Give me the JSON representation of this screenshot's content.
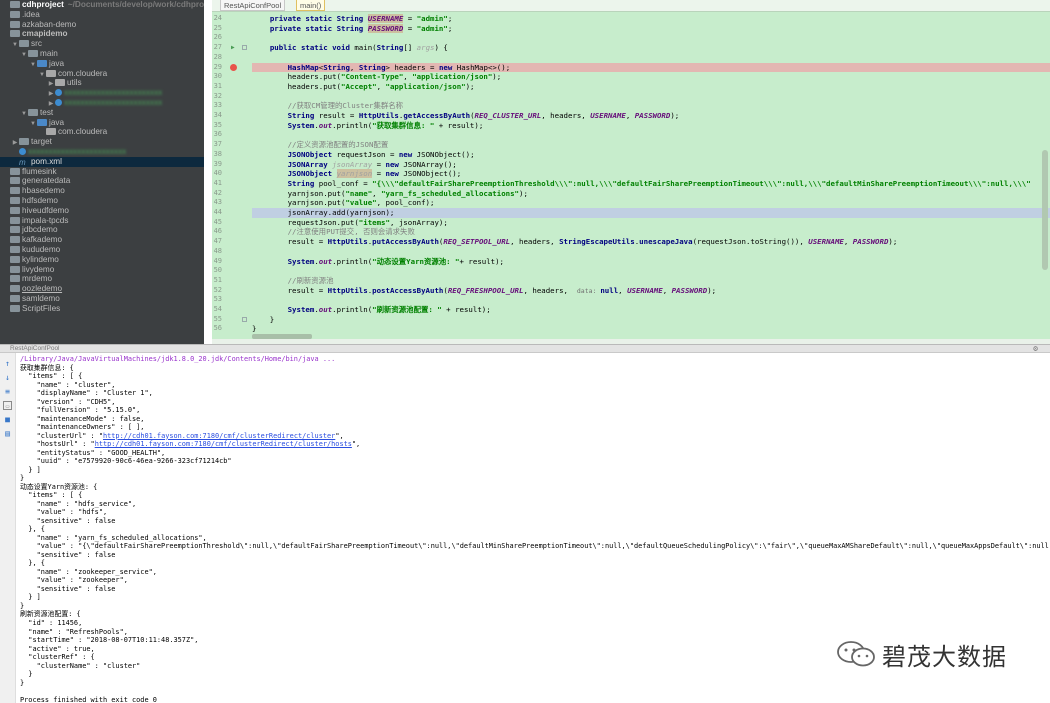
{
  "sidebar": {
    "items": [
      {
        "label": "cdhproject",
        "hint": "~/Documents/develop/work/cdhproject",
        "depth": 0,
        "icon": "folder",
        "root": true
      },
      {
        "label": ".idea",
        "depth": 0,
        "icon": "folder"
      },
      {
        "label": "azkaban-demo",
        "depth": 0,
        "icon": "folder"
      },
      {
        "label": "cmapidemo",
        "depth": 0,
        "icon": "folder",
        "bold": true
      },
      {
        "label": "src",
        "depth": 1,
        "icon": "folder",
        "arrow": "open"
      },
      {
        "label": "main",
        "depth": 2,
        "icon": "folder",
        "arrow": "open"
      },
      {
        "label": "java",
        "depth": 3,
        "icon": "src",
        "arrow": "open"
      },
      {
        "label": "com.cloudera",
        "depth": 4,
        "icon": "pkg",
        "arrow": "open"
      },
      {
        "label": "utils",
        "depth": 5,
        "icon": "pkg",
        "arrow": "closed"
      },
      {
        "label": "",
        "depth": 5,
        "icon": "cls",
        "arrow": "closed",
        "blurred": true
      },
      {
        "label": "",
        "depth": 5,
        "icon": "cls",
        "arrow": "closed",
        "blurred": true
      },
      {
        "label": "test",
        "depth": 2,
        "icon": "folder",
        "arrow": "open"
      },
      {
        "label": "java",
        "depth": 3,
        "icon": "src",
        "arrow": "open"
      },
      {
        "label": "com.cloudera",
        "depth": 4,
        "icon": "pkg"
      },
      {
        "label": "target",
        "depth": 1,
        "icon": "folder",
        "arrow": "closed"
      },
      {
        "label": "",
        "depth": 1,
        "icon": "cls",
        "blurred": true
      },
      {
        "label": "pom.xml",
        "depth": 1,
        "icon": "xml",
        "selected": true
      },
      {
        "label": "flumesink",
        "depth": 0,
        "icon": "folder"
      },
      {
        "label": "generatedata",
        "depth": 0,
        "icon": "folder"
      },
      {
        "label": "hbasedemo",
        "depth": 0,
        "icon": "folder"
      },
      {
        "label": "hdfsdemo",
        "depth": 0,
        "icon": "folder"
      },
      {
        "label": "hiveudfdemo",
        "depth": 0,
        "icon": "folder"
      },
      {
        "label": "impala-tpcds",
        "depth": 0,
        "icon": "folder"
      },
      {
        "label": "jdbcdemo",
        "depth": 0,
        "icon": "folder"
      },
      {
        "label": "kafkademo",
        "depth": 0,
        "icon": "folder"
      },
      {
        "label": "kududemo",
        "depth": 0,
        "icon": "folder"
      },
      {
        "label": "kylindemo",
        "depth": 0,
        "icon": "folder"
      },
      {
        "label": "livydemo",
        "depth": 0,
        "icon": "folder"
      },
      {
        "label": "mrdemo",
        "depth": 0,
        "icon": "folder"
      },
      {
        "label": "oozledemo",
        "depth": 0,
        "icon": "folder",
        "underline": true
      },
      {
        "label": "samldemo",
        "depth": 0,
        "icon": "folder"
      },
      {
        "label": "ScriptFiles",
        "depth": 0,
        "icon": "folder"
      }
    ]
  },
  "editor": {
    "tabs": [
      {
        "label": "RestApiConfPool",
        "active": false
      },
      {
        "label": "main()",
        "active": true
      }
    ],
    "line_numbers": [
      "24",
      "25",
      "26",
      "27",
      "28",
      "29",
      "30",
      "31",
      "32",
      "33",
      "34",
      "35",
      "36",
      "37",
      "38",
      "39",
      "40",
      "41",
      "42",
      "43",
      "44",
      "45",
      "46",
      "47",
      "48",
      "49",
      "50",
      "51",
      "52",
      "53",
      "54",
      "55",
      "56"
    ],
    "lines": [
      [
        {
          "t": "    "
        },
        {
          "t": "private static ",
          "c": "kw"
        },
        {
          "t": "String ",
          "c": "typ"
        },
        {
          "t": "USERNAME",
          "c": "fld mark"
        },
        {
          "t": " = "
        },
        {
          "t": "\"admin\"",
          "c": "str"
        },
        {
          "t": ";"
        }
      ],
      [
        {
          "t": "    "
        },
        {
          "t": "private static ",
          "c": "kw"
        },
        {
          "t": "String ",
          "c": "typ"
        },
        {
          "t": "PASSWORD",
          "c": "fld mark"
        },
        {
          "t": " = "
        },
        {
          "t": "\"admin\"",
          "c": "str"
        },
        {
          "t": ";"
        }
      ],
      [
        {
          "t": ""
        }
      ],
      [
        {
          "t": "    "
        },
        {
          "t": "public static void ",
          "c": "kw"
        },
        {
          "t": "main("
        },
        {
          "t": "String",
          "c": "typ"
        },
        {
          "t": "[] "
        },
        {
          "t": "args",
          "c": "var"
        },
        {
          "t": ") {"
        }
      ],
      [
        {
          "t": ""
        }
      ],
      [
        {
          "t": "        "
        },
        {
          "t": "HashMap",
          "c": "typ"
        },
        {
          "t": "<"
        },
        {
          "t": "String",
          "c": "typ"
        },
        {
          "t": ", "
        },
        {
          "t": "String",
          "c": "typ"
        },
        {
          "t": "> headers = "
        },
        {
          "t": "new ",
          "c": "kw"
        },
        {
          "t": "HashMap<>();"
        }
      ],
      [
        {
          "t": "        headers.put("
        },
        {
          "t": "\"Content-Type\"",
          "c": "str"
        },
        {
          "t": ", "
        },
        {
          "t": "\"application/json\"",
          "c": "str"
        },
        {
          "t": ");"
        }
      ],
      [
        {
          "t": "        headers.put("
        },
        {
          "t": "\"Accept\"",
          "c": "str"
        },
        {
          "t": ", "
        },
        {
          "t": "\"application/json\"",
          "c": "str"
        },
        {
          "t": ");"
        }
      ],
      [
        {
          "t": ""
        }
      ],
      [
        {
          "t": "        "
        },
        {
          "t": "//获取CM管理的Cluster集群名称",
          "c": "cmt"
        }
      ],
      [
        {
          "t": "        "
        },
        {
          "t": "String ",
          "c": "typ"
        },
        {
          "t": "result = "
        },
        {
          "t": "HttpUtils",
          "c": "typ"
        },
        {
          "t": "."
        },
        {
          "t": "getAccessByAuth",
          "c": "typ"
        },
        {
          "t": "("
        },
        {
          "t": "REQ_CLUSTER_URL",
          "c": "fld"
        },
        {
          "t": ", headers, "
        },
        {
          "t": "USERNAME",
          "c": "fld"
        },
        {
          "t": ", "
        },
        {
          "t": "PASSWORD",
          "c": "fld"
        },
        {
          "t": ");"
        }
      ],
      [
        {
          "t": "        "
        },
        {
          "t": "System",
          "c": "typ"
        },
        {
          "t": "."
        },
        {
          "t": "out",
          "c": "fld"
        },
        {
          "t": ".println("
        },
        {
          "t": "\"获取集群信息: \"",
          "c": "str"
        },
        {
          "t": " + result);"
        }
      ],
      [
        {
          "t": ""
        }
      ],
      [
        {
          "t": "        "
        },
        {
          "t": "//定义资源池配置的JSON配置",
          "c": "cmt"
        }
      ],
      [
        {
          "t": "        "
        },
        {
          "t": "JSONObject ",
          "c": "typ"
        },
        {
          "t": "requestJson = "
        },
        {
          "t": "new ",
          "c": "kw"
        },
        {
          "t": "JSONObject();"
        }
      ],
      [
        {
          "t": "        "
        },
        {
          "t": "JSONArray ",
          "c": "typ"
        },
        {
          "t": "jsonArray",
          "c": "var"
        },
        {
          "t": " = "
        },
        {
          "t": "new ",
          "c": "kw"
        },
        {
          "t": "JSONArray();"
        }
      ],
      [
        {
          "t": "        "
        },
        {
          "t": "JSONObject ",
          "c": "typ"
        },
        {
          "t": "yarnjson",
          "c": "var mark"
        },
        {
          "t": " = "
        },
        {
          "t": "new ",
          "c": "kw"
        },
        {
          "t": "JSONObject();"
        }
      ],
      [
        {
          "t": "        "
        },
        {
          "t": "String ",
          "c": "typ"
        },
        {
          "t": "pool_conf = "
        },
        {
          "t": "\"{\\\\\\\"defaultFairSharePreemptionThreshold\\\\\\\":null,\\\\\\\"defaultFairSharePreemptionTimeout\\\\\\\":null,\\\\\\\"defaultMinSharePreemptionTimeout\\\\\\\":null,\\\\\\\"",
          "c": "str"
        }
      ],
      [
        {
          "t": "        yarnjson.put("
        },
        {
          "t": "\"name\"",
          "c": "str"
        },
        {
          "t": ", "
        },
        {
          "t": "\"yarn_fs_scheduled_allocations\"",
          "c": "str"
        },
        {
          "t": ");"
        }
      ],
      [
        {
          "t": "        yarnjson.put("
        },
        {
          "t": "\"value\"",
          "c": "str"
        },
        {
          "t": ", pool_conf);"
        }
      ],
      [
        {
          "t": "        jsonArray.add(yarnjson);"
        }
      ],
      [
        {
          "t": "        requestJson.put("
        },
        {
          "t": "\"items\"",
          "c": "str"
        },
        {
          "t": ", jsonArray);"
        }
      ],
      [
        {
          "t": "        "
        },
        {
          "t": "//注意使用PUT提交, 否则会请求失败",
          "c": "cmt"
        }
      ],
      [
        {
          "t": "        result = "
        },
        {
          "t": "HttpUtils",
          "c": "typ"
        },
        {
          "t": "."
        },
        {
          "t": "putAccessByAuth",
          "c": "typ"
        },
        {
          "t": "("
        },
        {
          "t": "REQ_SETPOOL_URL",
          "c": "fld"
        },
        {
          "t": ", headers, "
        },
        {
          "t": "StringEscapeUtils",
          "c": "typ"
        },
        {
          "t": "."
        },
        {
          "t": "unescapeJava",
          "c": "typ"
        },
        {
          "t": "(requestJson.toString()), "
        },
        {
          "t": "USERNAME",
          "c": "fld"
        },
        {
          "t": ", "
        },
        {
          "t": "PASSWORD",
          "c": "fld"
        },
        {
          "t": ");"
        }
      ],
      [
        {
          "t": ""
        }
      ],
      [
        {
          "t": "        "
        },
        {
          "t": "System",
          "c": "typ"
        },
        {
          "t": "."
        },
        {
          "t": "out",
          "c": "fld"
        },
        {
          "t": ".println("
        },
        {
          "t": "\"动态设置Yarn资源池: \"",
          "c": "str"
        },
        {
          "t": "+ result);"
        }
      ],
      [
        {
          "t": ""
        }
      ],
      [
        {
          "t": "        "
        },
        {
          "t": "//刷新资源池",
          "c": "cmt"
        }
      ],
      [
        {
          "t": "        result = "
        },
        {
          "t": "HttpUtils",
          "c": "typ"
        },
        {
          "t": "."
        },
        {
          "t": "postAccessByAuth",
          "c": "typ"
        },
        {
          "t": "("
        },
        {
          "t": "REQ_FRESHPOOL_URL",
          "c": "fld"
        },
        {
          "t": ", headers,  "
        },
        {
          "t": "data: ",
          "c": "hint2"
        },
        {
          "t": "null",
          "c": "kw"
        },
        {
          "t": ", "
        },
        {
          "t": "USERNAME",
          "c": "fld"
        },
        {
          "t": ", "
        },
        {
          "t": "PASSWORD",
          "c": "fld"
        },
        {
          "t": ");"
        }
      ],
      [
        {
          "t": ""
        }
      ],
      [
        {
          "t": "        "
        },
        {
          "t": "System",
          "c": "typ"
        },
        {
          "t": "."
        },
        {
          "t": "out",
          "c": "fld"
        },
        {
          "t": ".println("
        },
        {
          "t": "\"刷新资源池配置: \"",
          "c": "str"
        },
        {
          "t": " + result);"
        }
      ],
      [
        {
          "t": "    }"
        }
      ],
      [
        {
          "t": "}"
        }
      ]
    ],
    "highlight_line": 20,
    "error_line": 5,
    "breakpoint_line": 5,
    "run_line": 3
  },
  "run": {
    "title": "RestApiConfPool",
    "lines": [
      {
        "t": "/Library/Java/JavaVirtualMachines/jdk1.8.0_20.jdk/Contents/Home/bin/java ...",
        "cls": "cmdline"
      },
      {
        "t": "获取集群信息: {"
      },
      {
        "t": "  \"items\" : [ {"
      },
      {
        "t": "    \"name\" : \"cluster\","
      },
      {
        "t": "    \"displayName\" : \"Cluster 1\","
      },
      {
        "t": "    \"version\" : \"CDH5\","
      },
      {
        "t": "    \"fullVersion\" : \"5.15.0\","
      },
      {
        "t": "    \"maintenanceMode\" : false,"
      },
      {
        "t": "    \"maintenanceOwners\" : [ ],"
      },
      {
        "t": "    \"clusterUrl\" : \"",
        "link": "http://cdh01.fayson.com:7180/cmf/clusterRedirect/cluster",
        "tail": "\","
      },
      {
        "t": "    \"hostsUrl\" : \"",
        "link": "http://cdh01.fayson.com:7180/cmf/clusterRedirect/cluster/hosts",
        "tail": "\","
      },
      {
        "t": "    \"entityStatus\" : \"GOOD_HEALTH\","
      },
      {
        "t": "    \"uuid\" : \"e7579920-90c6-46ea-9266-323cf71214cb\""
      },
      {
        "t": "  } ]"
      },
      {
        "t": "}"
      },
      {
        "t": "动态设置Yarn资源池: {"
      },
      {
        "t": "  \"items\" : [ {"
      },
      {
        "t": "    \"name\" : \"hdfs_service\","
      },
      {
        "t": "    \"value\" : \"hdfs\","
      },
      {
        "t": "    \"sensitive\" : false"
      },
      {
        "t": "  }, {"
      },
      {
        "t": "    \"name\" : \"yarn_fs_scheduled_allocations\","
      },
      {
        "t": "    \"value\" : \"{\\\"defaultFairSharePreemptionThreshold\\\":null,\\\"defaultFairSharePreemptionTimeout\\\":null,\\\"defaultMinSharePreemptionTimeout\\\":null,\\\"defaultQueueSchedulingPolicy\\\":\\\"fair\\\",\\\"queueMaxAMShareDefault\\\":null,\\\"queueMaxAppsDefault\\\":null,\\\"queueF"
      },
      {
        "t": "    \"sensitive\" : false"
      },
      {
        "t": "  }, {"
      },
      {
        "t": "    \"name\" : \"zookeeper_service\","
      },
      {
        "t": "    \"value\" : \"zookeeper\","
      },
      {
        "t": "    \"sensitive\" : false"
      },
      {
        "t": "  } ]"
      },
      {
        "t": "}"
      },
      {
        "t": "刷新资源池配置: {"
      },
      {
        "t": "  \"id\" : 11456,"
      },
      {
        "t": "  \"name\" : \"RefreshPools\","
      },
      {
        "t": "  \"startTime\" : \"2018-08-07T10:11:48.357Z\","
      },
      {
        "t": "  \"active\" : true,"
      },
      {
        "t": "  \"clusterRef\" : {"
      },
      {
        "t": "    \"clusterName\" : \"cluster\""
      },
      {
        "t": "  }"
      },
      {
        "t": "}"
      },
      {
        "t": ""
      },
      {
        "t": "Process finished with exit code 0"
      }
    ]
  },
  "watermark": {
    "text": "碧茂大数据"
  }
}
